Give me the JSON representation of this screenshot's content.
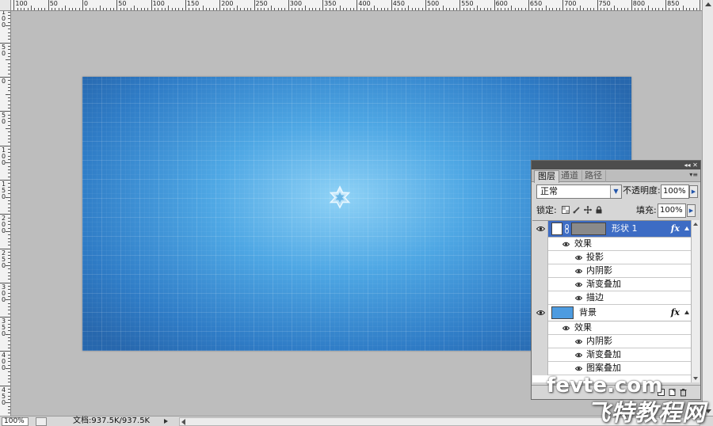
{
  "rulers": {
    "top_labels": [
      "100",
      "50",
      "0",
      "50",
      "100",
      "150",
      "200",
      "250",
      "300",
      "350",
      "400",
      "450",
      "500",
      "550",
      "600",
      "650",
      "700",
      "750",
      "800",
      "850"
    ],
    "left_labels": [
      "100",
      "50",
      "0",
      "50",
      "100",
      "150",
      "200",
      "250",
      "300",
      "350",
      "400",
      "450",
      "500"
    ]
  },
  "layers_panel": {
    "tabs": [
      {
        "label": "图层",
        "active": true
      },
      {
        "label": "通道",
        "active": false
      },
      {
        "label": "路径",
        "active": false
      }
    ],
    "blend_mode": "正常",
    "opacity_label": "不透明度:",
    "opacity_value": "100%",
    "lock_label": "锁定:",
    "fill_label": "填充:",
    "fill_value": "100%",
    "layers": [
      {
        "name": "形状 1",
        "selected": true,
        "effects_label": "效果",
        "effects": [
          "投影",
          "内阴影",
          "渐变叠加",
          "描边"
        ]
      },
      {
        "name": "背景",
        "selected": false,
        "effects_label": "效果",
        "effects": [
          "内阴影",
          "渐变叠加",
          "图案叠加"
        ]
      }
    ],
    "fx_label": "fx"
  },
  "status_bar": {
    "zoom": "100%",
    "doc_info": "文档:937.5K/937.5K"
  },
  "watermark": {
    "site": "fevte.com",
    "cn": "飞特教程网"
  },
  "colors": {
    "canvas_center": "#8fd2f6",
    "canvas_edge": "#2767ad",
    "selected_layer": "#3d6cc4",
    "workspace": "#bdbdbd"
  },
  "icons": [
    "eye-icon",
    "star-shape",
    "lock-transparent-icon",
    "lock-brush-icon",
    "lock-move-icon",
    "lock-all-icon",
    "chain-link-icon",
    "fx-icon"
  ]
}
